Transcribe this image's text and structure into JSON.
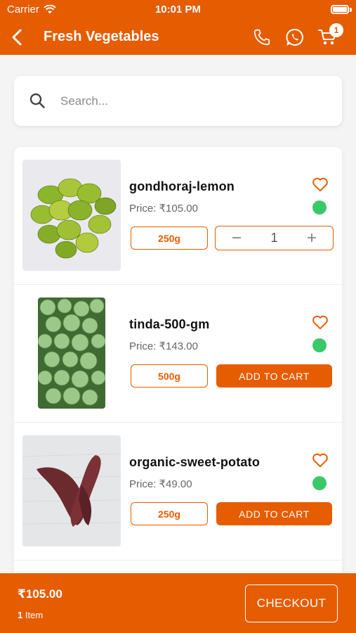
{
  "status_bar": {
    "carrier": "Carrier",
    "time": "10:01 PM"
  },
  "nav": {
    "title": "Fresh Vegetables",
    "cart_count": "1"
  },
  "search": {
    "placeholder": "Search..."
  },
  "products": [
    {
      "name": "gondhoraj-lemon",
      "price": "Price: ₹105.00",
      "weight": "250g",
      "quantity": "1",
      "in_cart": true,
      "thumbnail": "lemon"
    },
    {
      "name": "tinda-500-gm",
      "price": "Price: ₹143.00",
      "weight": "500g",
      "add_label": "ADD TO CART",
      "in_cart": false,
      "thumbnail": "tinda"
    },
    {
      "name": "organic-sweet-potato",
      "price": "Price: ₹49.00",
      "weight": "250g",
      "add_label": "ADD TO CART",
      "in_cart": false,
      "thumbnail": "sweet-potato"
    }
  ],
  "footer": {
    "total": "₹105.00",
    "item_count": "1",
    "item_label": "Item",
    "checkout_label": "CHECKOUT"
  },
  "colors": {
    "accent": "#e65c00",
    "stock": "#3ac96a",
    "background": "#f4f4f4"
  }
}
